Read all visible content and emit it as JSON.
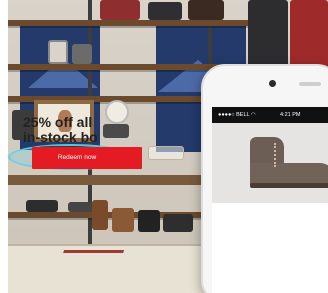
{
  "phone": {
    "status_bar": {
      "carrier": "●●●●○ BELL ◠",
      "time": "4:21 PM"
    },
    "promo": {
      "headline_line1": "25% off all",
      "headline_line2": "in-stock bo",
      "cta_label": "Redeem now"
    }
  },
  "colors": {
    "accent": "#e41b23",
    "navy": "#233a6b",
    "glow": "#5ad2eb"
  },
  "icons": [
    "camera-icon",
    "speaker-icon"
  ]
}
